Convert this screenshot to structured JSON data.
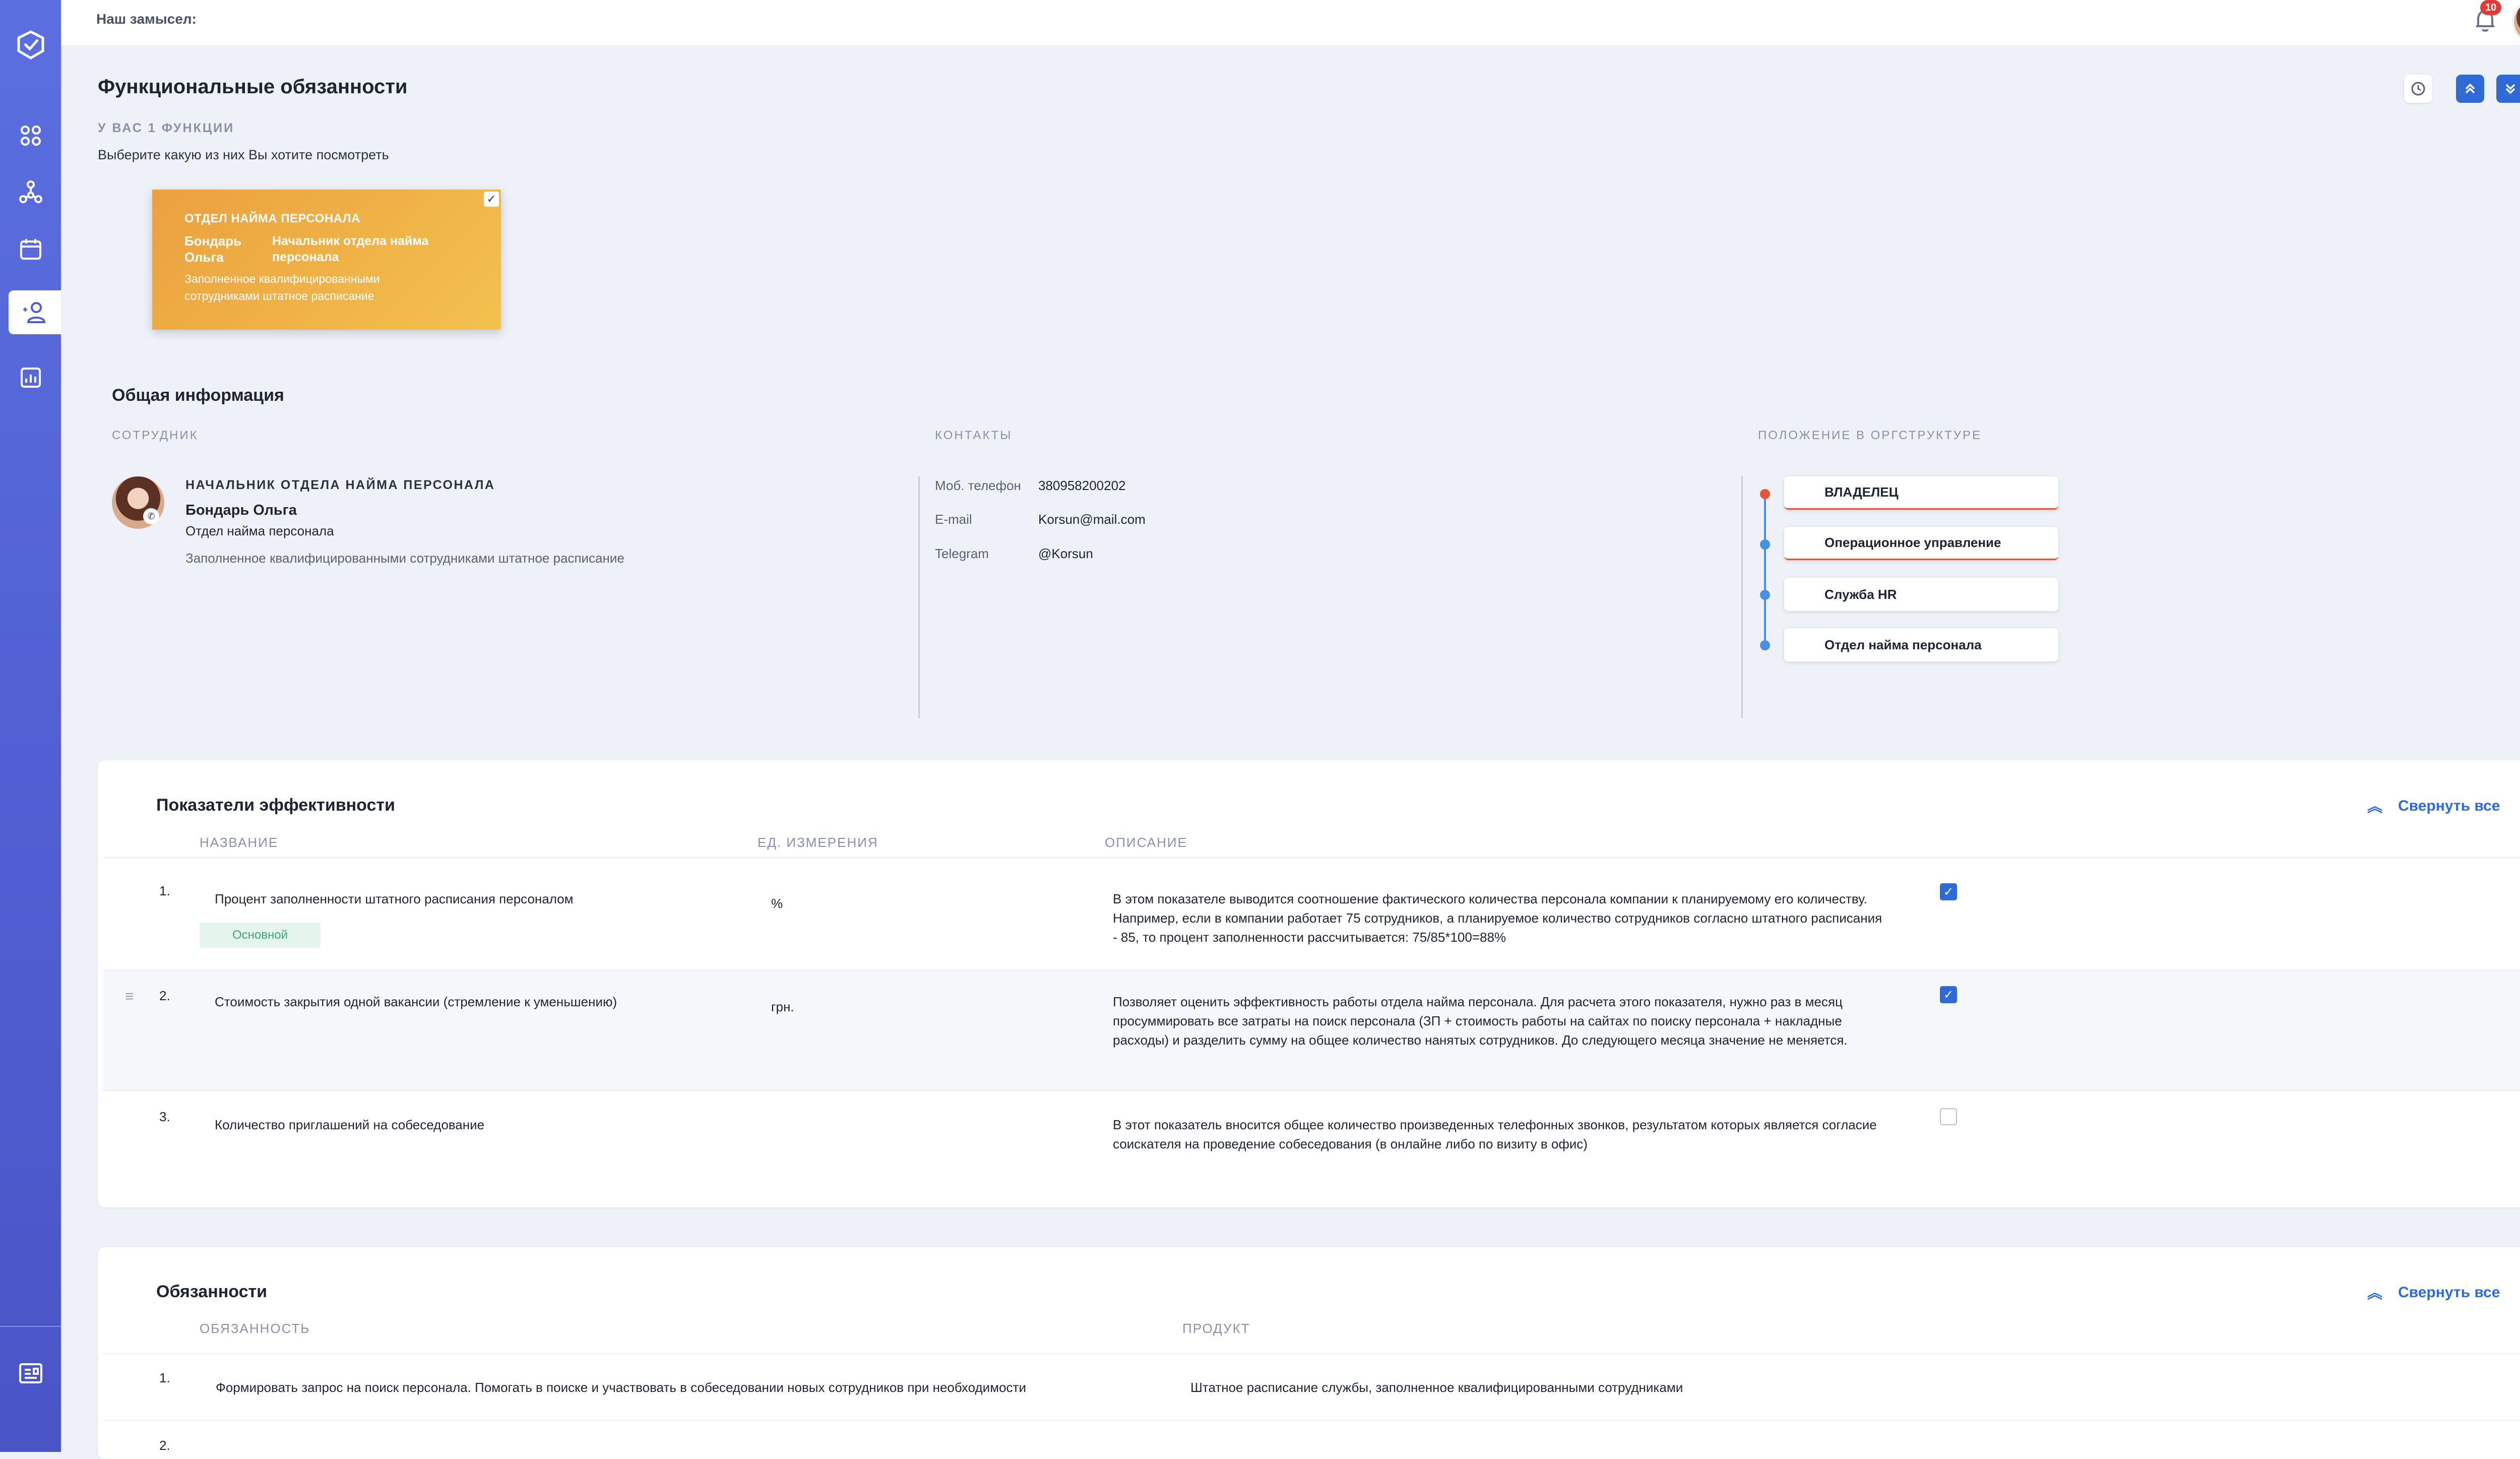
{
  "topbar": {
    "idea_label": "Наш замысел:",
    "notification_count": "10"
  },
  "header": {
    "title": "Функциональные обязанности",
    "count_label": "У ВАС 1 ФУНКЦИИ",
    "hint": "Выберите какую из них Вы хотите посмотреть"
  },
  "card": {
    "department": "ОТДЕЛ НАЙМА ПЕРСОНАЛА",
    "employee": "Бондарь Ольга",
    "role": "Начальник отдела найма персонала",
    "description": "Заполненное квалифицированными сотрудниками штатное расписание"
  },
  "general": {
    "title": "Общая информация",
    "col_employee": "СОТРУДНИК",
    "col_contacts": "КОНТАКТЫ",
    "col_position": "ПОЛОЖЕНИЕ В ОРГСТРУКТУРЕ",
    "employee": {
      "position": "НАЧАЛЬНИК ОТДЕЛА НАЙМА ПЕРСОНАЛА",
      "name": "Бондарь Ольга",
      "department": "Отдел найма персонала",
      "description": "Заполненное квалифицированными сотрудниками штатное расписание"
    },
    "contacts": [
      {
        "label": "Моб. телефон",
        "value": "380958200202"
      },
      {
        "label": "E-mail",
        "value": "Korsun@mail.com"
      },
      {
        "label": "Telegram",
        "value": "@Korsun"
      }
    ],
    "org": [
      "ВЛАДЕЛЕЦ",
      "Операционное управление",
      "Служба HR",
      "Отдел найма персонала"
    ]
  },
  "kpi": {
    "title": "Показатели эффективности",
    "collapse_label": "Свернуть все",
    "col_name": "НАЗВАНИЕ",
    "col_unit": "ЕД. ИЗМЕРЕНИЯ",
    "col_desc": "ОПИСАНИЕ",
    "main_tag": "Основной",
    "rows": [
      {
        "num": "1.",
        "name": "Процент заполненности штатного расписания персоналом",
        "unit": "%",
        "desc": "В этом показателе выводится соотношение фактического количества персонала компании к планируемому его количеству. Например, если в компании работает 75 сотрудников, а планируемое количество сотрудников согласно штатного расписания - 85, то процент заполненности рассчитывается: 75/85*100=88%",
        "checked": true
      },
      {
        "num": "2.",
        "name": "Стоимость закрытия одной вакансии (стремление к уменьшению)",
        "unit": "грн.",
        "desc": "Позволяет оценить эффективность работы отдела найма персонала. Для расчета этого показателя, нужно раз в месяц просуммировать все затраты на поиск персонала (ЗП + стоимость работы на сайтах по поиску персонала + накладные расходы) и разделить сумму на общее количество нанятых сотрудников. До следующего месяца значение не меняется.",
        "checked": true
      },
      {
        "num": "3.",
        "name": "Количество приглашений на собеседование",
        "unit": "",
        "desc": "В этот показатель вносится общее количество произведенных телефонных звонков, результатом которых является согласие соискателя на проведение собеседования (в онлайне либо по визиту в офис)",
        "checked": false
      }
    ]
  },
  "duties": {
    "title": "Обязанности",
    "collapse_label": "Свернуть все",
    "col_duty": "ОБЯЗАННОСТЬ",
    "col_product": "ПРОДУКТ",
    "rows": [
      {
        "num": "1.",
        "duty": "Формировать запрос на поиск персонала. Помогать в поиске и участвовать в собеседовании новых сотрудников при необходимости",
        "product": "Штатное расписание службы, заполненное квалифицированными сотрудниками"
      },
      {
        "num": "2.",
        "duty": "",
        "product": ""
      }
    ]
  }
}
